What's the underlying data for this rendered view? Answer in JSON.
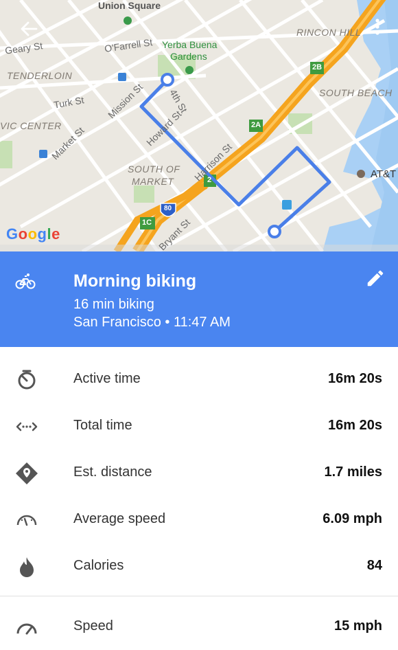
{
  "map": {
    "labels": {
      "union_square": "Union Square",
      "geary": "Geary St",
      "ofarrell": "O'Farrell St",
      "yerba1": "Yerba Buena",
      "yerba2": "Gardens",
      "rincon": "RINCON HILL",
      "tenderloin": "TENDERLOIN",
      "turk": "Turk St",
      "mission": "Mission St",
      "fourth": "4th St",
      "howard": "Howard St",
      "south_beach": "SOUTH BEACH",
      "civic": "VIC CENTER",
      "market": "Market St",
      "harrison": "Harrison St",
      "som1": "SOUTH OF",
      "som2": "MARKET",
      "att": "AT&T",
      "bryant": "Bryant St",
      "exit_2b": "2B",
      "exit_2a": "2A",
      "exit_2": "2",
      "exit_1c": "1C",
      "hwy_80": "80"
    },
    "google": [
      "G",
      "o",
      "o",
      "g",
      "l",
      "e"
    ],
    "google_colors": [
      "#4285f4",
      "#ea4335",
      "#fbbc05",
      "#4285f4",
      "#34a853",
      "#ea4335"
    ],
    "route_color": "#4a7fe8",
    "highway_color": "#f5a41e"
  },
  "activity": {
    "title": "Morning biking",
    "duration": "16 min biking",
    "place_time": "San Francisco • 11:47 AM",
    "header_color": "#4a85f0"
  },
  "stats": [
    {
      "icon": "timer-icon",
      "label": "Active time",
      "value": "16m 20s"
    },
    {
      "icon": "total-time-icon",
      "label": "Total time",
      "value": "16m 20s"
    },
    {
      "icon": "location-diamond-icon",
      "label": "Est. distance",
      "value": "1.7 miles"
    },
    {
      "icon": "speedometer-icon",
      "label": "Average speed",
      "value": "6.09 mph"
    },
    {
      "icon": "flame-icon",
      "label": "Calories",
      "value": "84"
    },
    {
      "icon": "speed-gauge-icon",
      "label": "Speed",
      "value": "15 mph"
    }
  ]
}
